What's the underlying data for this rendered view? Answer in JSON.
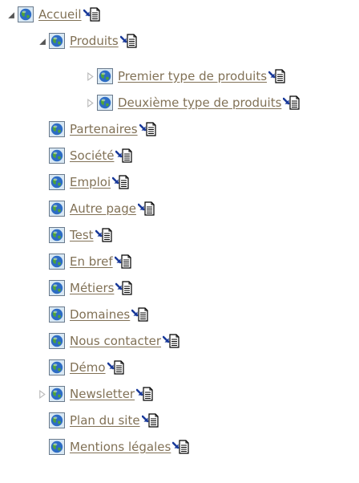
{
  "colors": {
    "link": "#817156",
    "globe_blue": "#2c6cc4",
    "globe_green": "#4da33b",
    "arrow_expanded": "#555555",
    "arrow_collapsed": "#b8b8b8"
  },
  "icons": {
    "page": "globe-icon",
    "action": "document-link-icon",
    "expanded": "triangle-expanded-icon",
    "collapsed": "triangle-collapsed-icon"
  },
  "tree": [
    {
      "label": "Accueil",
      "state": "expanded"
    },
    {
      "label": "Produits",
      "state": "expanded"
    },
    {
      "label": "Premier type de produits",
      "state": "collapsed"
    },
    {
      "label": "Deuxième type de produits",
      "state": "collapsed"
    },
    {
      "label": "Partenaires",
      "state": "none"
    },
    {
      "label": "Société",
      "state": "none"
    },
    {
      "label": "Emploi",
      "state": "none"
    },
    {
      "label": "Autre page",
      "state": "none"
    },
    {
      "label": "Test",
      "state": "none"
    },
    {
      "label": "En bref",
      "state": "none"
    },
    {
      "label": "Métiers",
      "state": "none"
    },
    {
      "label": "Domaines",
      "state": "none"
    },
    {
      "label": "Nous contacter",
      "state": "none"
    },
    {
      "label": "Démo",
      "state": "none"
    },
    {
      "label": "Newsletter",
      "state": "collapsed"
    },
    {
      "label": "Plan du site",
      "state": "none"
    },
    {
      "label": "Mentions légales",
      "state": "none"
    }
  ]
}
